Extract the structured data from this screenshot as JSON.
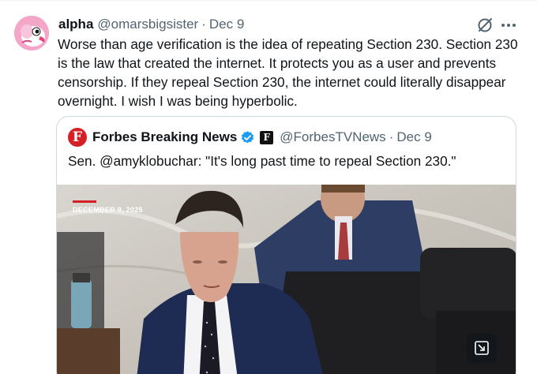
{
  "tweet": {
    "author_name": "alpha",
    "handle": "@omarsbigsister",
    "separator": "·",
    "date": "Dec 9",
    "text": "Worse than age verification is the idea of repeating Section 230. Section 230 is the law that created the internet. It protects you as a user and prevents censorship. If they repeal Section 230, the internet could literally disappear overnight. I wish I was being hyperbolic."
  },
  "quote": {
    "author_name": "Forbes Breaking News",
    "logo_letter": "F",
    "affiliate_letter": "F",
    "handle": "@ForbesTVNews",
    "separator": "·",
    "date": "Dec 9",
    "text": "Sen. @amyklobuchar: \"It's long past time to repeal Section 230.\"",
    "media": {
      "date_caption": "DECEMBER 9, 2025"
    }
  },
  "icons": {
    "grok": "grok-icon",
    "more": "more-icon",
    "verified": "verified-badge-icon",
    "expand": "expand-media-icon"
  },
  "colors": {
    "forbes_red": "#d51f26",
    "verified_blue": "#1d9bf0",
    "secondary_text": "#536471",
    "border": "#cfd9de"
  }
}
